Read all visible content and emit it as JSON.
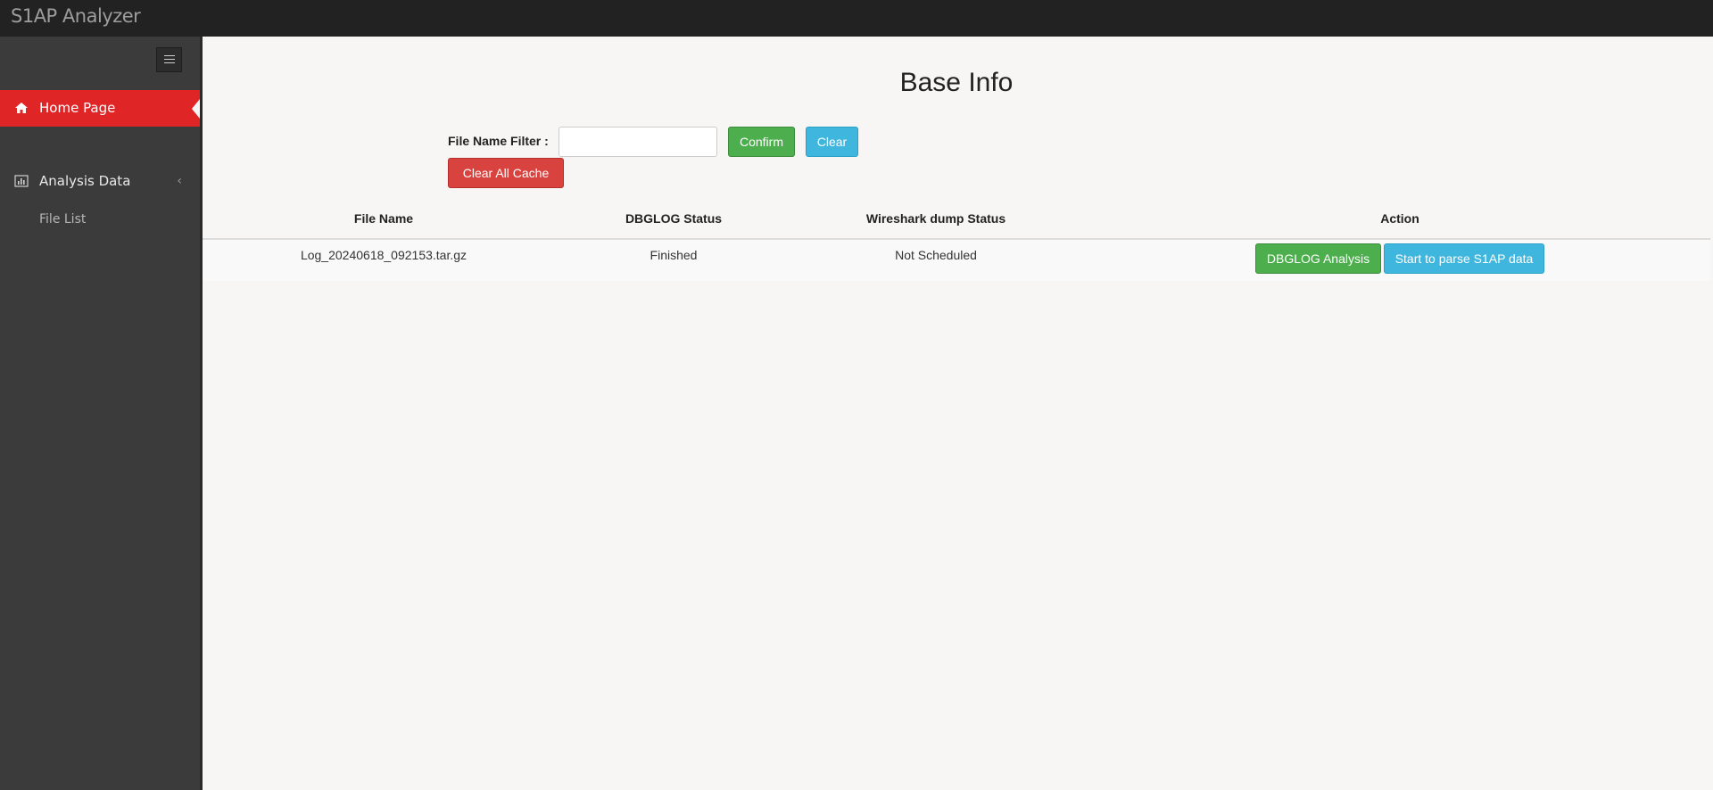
{
  "app": {
    "title": "S1AP Analyzer"
  },
  "sidebar": {
    "items": [
      {
        "label": "Home Page",
        "icon": "home-icon",
        "active": true
      },
      {
        "label": "Analysis Data",
        "icon": "bar-chart-icon",
        "active": false
      },
      {
        "label": "File List",
        "icon": "",
        "active": false
      }
    ]
  },
  "main": {
    "title": "Base Info",
    "filter": {
      "label": "File Name Filter :",
      "value": "",
      "placeholder": ""
    },
    "buttons": {
      "confirm": "Confirm",
      "clear": "Clear",
      "clear_all_cache": "Clear All Cache"
    },
    "table": {
      "headers": [
        "File Name",
        "DBGLOG Status",
        "Wireshark dump Status",
        "Action"
      ],
      "rows": [
        {
          "file_name": "Log_20240618_092153.tar.gz",
          "dbglog_status": "Finished",
          "wireshark_status": "Not Scheduled",
          "actions": [
            "DBGLOG Analysis",
            "Start to parse S1AP data"
          ]
        }
      ]
    }
  },
  "colors": {
    "topbar": "#222222",
    "sidebar": "#3b3b3b",
    "active_nav": "#e02527",
    "success": "#4cae4c",
    "info": "#3fb6dd",
    "danger": "#d9433f"
  }
}
